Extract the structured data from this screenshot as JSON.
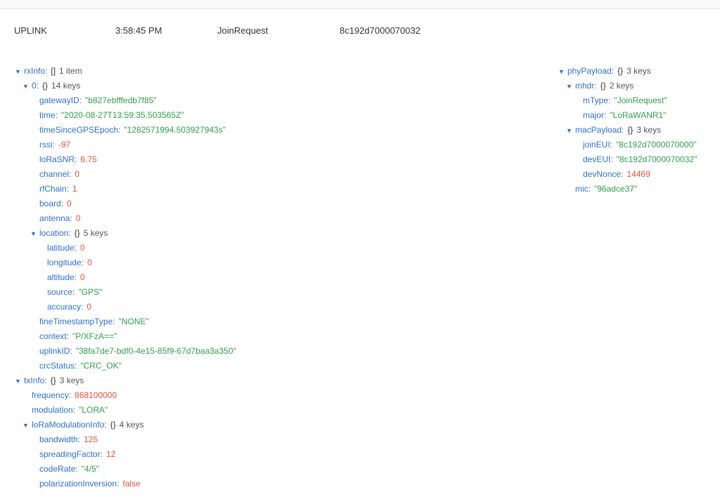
{
  "header": {
    "direction": "UPLINK",
    "time": "3:58:45 PM",
    "type": "JoinRequest",
    "devEUI": "8c192d7000070032"
  },
  "left_tree": [
    {
      "depth": 0,
      "key": "rxInfo",
      "kind": "arr",
      "meta": "1 item"
    },
    {
      "depth": 1,
      "key": "0",
      "kind": "obj",
      "meta": "14 keys"
    },
    {
      "depth": 2,
      "key": "gatewayID",
      "kind": "str",
      "value": "\"b827ebfffedb7f85\""
    },
    {
      "depth": 2,
      "key": "time",
      "kind": "str",
      "value": "\"2020-08-27T13:59:35.503565Z\""
    },
    {
      "depth": 2,
      "key": "timeSinceGPSEpoch",
      "kind": "str",
      "value": "\"1282571994.503927943s\""
    },
    {
      "depth": 2,
      "key": "rssi",
      "kind": "num",
      "value": "-97"
    },
    {
      "depth": 2,
      "key": "loRaSNR",
      "kind": "num",
      "value": "6.75"
    },
    {
      "depth": 2,
      "key": "channel",
      "kind": "num",
      "value": "0"
    },
    {
      "depth": 2,
      "key": "rfChain",
      "kind": "num",
      "value": "1"
    },
    {
      "depth": 2,
      "key": "board",
      "kind": "num",
      "value": "0"
    },
    {
      "depth": 2,
      "key": "antenna",
      "kind": "num",
      "value": "0"
    },
    {
      "depth": 2,
      "key": "location",
      "kind": "obj",
      "meta": "5 keys"
    },
    {
      "depth": 3,
      "key": "latitude",
      "kind": "num",
      "value": "0"
    },
    {
      "depth": 3,
      "key": "longitude",
      "kind": "num",
      "value": "0"
    },
    {
      "depth": 3,
      "key": "altitude",
      "kind": "num",
      "value": "0"
    },
    {
      "depth": 3,
      "key": "source",
      "kind": "str",
      "value": "\"GPS\""
    },
    {
      "depth": 3,
      "key": "accuracy",
      "kind": "num",
      "value": "0"
    },
    {
      "depth": 2,
      "key": "fineTimestampType",
      "kind": "str",
      "value": "\"NONE\""
    },
    {
      "depth": 2,
      "key": "context",
      "kind": "str",
      "value": "\"P/XFzA==\""
    },
    {
      "depth": 2,
      "key": "uplinkID",
      "kind": "str",
      "value": "\"38fa7de7-bdf0-4e15-85f9-67d7baa3a350\""
    },
    {
      "depth": 2,
      "key": "crcStatus",
      "kind": "str",
      "value": "\"CRC_OK\""
    },
    {
      "depth": 0,
      "key": "txInfo",
      "kind": "obj",
      "meta": "3 keys"
    },
    {
      "depth": 1,
      "key": "frequency",
      "kind": "num",
      "value": "868100000"
    },
    {
      "depth": 1,
      "key": "modulation",
      "kind": "str",
      "value": "\"LORA\""
    },
    {
      "depth": 1,
      "key": "loRaModulationInfo",
      "kind": "obj",
      "meta": "4 keys"
    },
    {
      "depth": 2,
      "key": "bandwidth",
      "kind": "num",
      "value": "125"
    },
    {
      "depth": 2,
      "key": "spreadingFactor",
      "kind": "num",
      "value": "12"
    },
    {
      "depth": 2,
      "key": "codeRate",
      "kind": "str",
      "value": "\"4/5\""
    },
    {
      "depth": 2,
      "key": "polarizationInversion",
      "kind": "bool",
      "value": "false"
    }
  ],
  "right_tree": [
    {
      "depth": 0,
      "key": "phyPayload",
      "kind": "obj",
      "meta": "3 keys"
    },
    {
      "depth": 1,
      "key": "mhdr",
      "kind": "obj",
      "meta": "2 keys"
    },
    {
      "depth": 2,
      "key": "mType",
      "kind": "str",
      "value": "\"JoinRequest\""
    },
    {
      "depth": 2,
      "key": "major",
      "kind": "str",
      "value": "\"LoRaWANR1\""
    },
    {
      "depth": 1,
      "key": "macPayload",
      "kind": "obj",
      "meta": "3 keys"
    },
    {
      "depth": 2,
      "key": "joinEUI",
      "kind": "str",
      "value": "\"8c192d7000070000\""
    },
    {
      "depth": 2,
      "key": "devEUI",
      "kind": "str",
      "value": "\"8c192d7000070032\""
    },
    {
      "depth": 2,
      "key": "devNonce",
      "kind": "num",
      "value": "14469"
    },
    {
      "depth": 1,
      "key": "mic",
      "kind": "str",
      "value": "\"96adce37\""
    }
  ],
  "colors": {
    "key": "#2f6fce",
    "string": "#2e9f4b",
    "number": "#e8513a"
  }
}
